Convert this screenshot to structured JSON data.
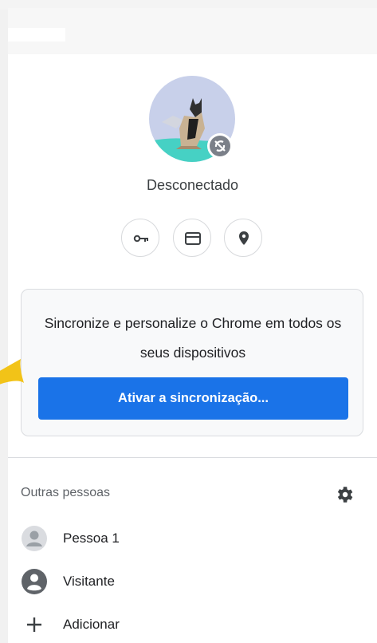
{
  "profile": {
    "status": "Desconectado",
    "avatar_icon": "cat-avatar",
    "badge_icon": "sync-off-icon"
  },
  "quick_actions": [
    {
      "icon": "key-icon",
      "label": "Senhas"
    },
    {
      "icon": "credit-card-icon",
      "label": "Formas de pagamento"
    },
    {
      "icon": "location-pin-icon",
      "label": "Endereços"
    }
  ],
  "sync_card": {
    "text": "Sincronize e personalize o Chrome em todos os seus dispositivos",
    "button_label": "Ativar a sincronização..."
  },
  "others": {
    "title": "Outras pessoas",
    "settings_icon": "gear-icon",
    "people": [
      {
        "label": "Pessoa 1",
        "icon": "person-avatar-icon"
      },
      {
        "label": "Visitante",
        "icon": "guest-icon"
      },
      {
        "label": "Adicionar",
        "icon": "plus-icon"
      }
    ]
  },
  "colors": {
    "accent": "#1a73e8",
    "card_bg": "#f8f9fa",
    "annotation_arrow": "#f2c318"
  }
}
